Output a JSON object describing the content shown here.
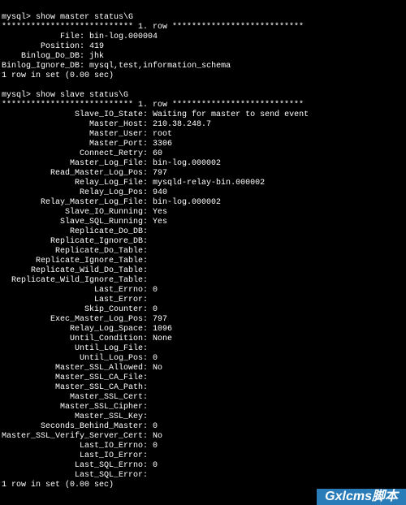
{
  "prompt_prefix": "mysql> ",
  "cmd_master": "show master status\\G",
  "row_header": "*************************** 1. row ***************************",
  "master_status": [
    {
      "key": "File",
      "val": "bin-log.000004"
    },
    {
      "key": "Position",
      "val": "419"
    },
    {
      "key": "Binlog_Do_DB",
      "val": "jhk"
    },
    {
      "key": "Binlog_Ignore_DB",
      "val": "mysql,test,information_schema"
    }
  ],
  "rows_in_set": "1 row in set (0.00 sec)",
  "cmd_slave": "show slave status\\G",
  "slave_status": [
    {
      "key": "Slave_IO_State",
      "val": "Waiting for master to send event"
    },
    {
      "key": "Master_Host",
      "val": "210.38.248.7"
    },
    {
      "key": "Master_User",
      "val": "root"
    },
    {
      "key": "Master_Port",
      "val": "3306"
    },
    {
      "key": "Connect_Retry",
      "val": "60"
    },
    {
      "key": "Master_Log_File",
      "val": "bin-log.000002"
    },
    {
      "key": "Read_Master_Log_Pos",
      "val": "797"
    },
    {
      "key": "Relay_Log_File",
      "val": "mysqld-relay-bin.000002"
    },
    {
      "key": "Relay_Log_Pos",
      "val": "940"
    },
    {
      "key": "Relay_Master_Log_File",
      "val": "bin-log.000002"
    },
    {
      "key": "Slave_IO_Running",
      "val": "Yes"
    },
    {
      "key": "Slave_SQL_Running",
      "val": "Yes"
    },
    {
      "key": "Replicate_Do_DB",
      "val": ""
    },
    {
      "key": "Replicate_Ignore_DB",
      "val": ""
    },
    {
      "key": "Replicate_Do_Table",
      "val": ""
    },
    {
      "key": "Replicate_Ignore_Table",
      "val": ""
    },
    {
      "key": "Replicate_Wild_Do_Table",
      "val": ""
    },
    {
      "key": "Replicate_Wild_Ignore_Table",
      "val": ""
    },
    {
      "key": "Last_Errno",
      "val": "0"
    },
    {
      "key": "Last_Error",
      "val": ""
    },
    {
      "key": "Skip_Counter",
      "val": "0"
    },
    {
      "key": "Exec_Master_Log_Pos",
      "val": "797"
    },
    {
      "key": "Relay_Log_Space",
      "val": "1096"
    },
    {
      "key": "Until_Condition",
      "val": "None"
    },
    {
      "key": "Until_Log_File",
      "val": ""
    },
    {
      "key": "Until_Log_Pos",
      "val": "0"
    },
    {
      "key": "Master_SSL_Allowed",
      "val": "No"
    },
    {
      "key": "Master_SSL_CA_File",
      "val": ""
    },
    {
      "key": "Master_SSL_CA_Path",
      "val": ""
    },
    {
      "key": "Master_SSL_Cert",
      "val": ""
    },
    {
      "key": "Master_SSL_Cipher",
      "val": ""
    },
    {
      "key": "Master_SSL_Key",
      "val": ""
    },
    {
      "key": "Seconds_Behind_Master",
      "val": "0"
    },
    {
      "key": "Master_SSL_Verify_Server_Cert",
      "val": "No"
    },
    {
      "key": "Last_IO_Errno",
      "val": "0"
    },
    {
      "key": "Last_IO_Error",
      "val": ""
    },
    {
      "key": "Last_SQL_Errno",
      "val": "0"
    },
    {
      "key": "Last_SQL_Error",
      "val": ""
    }
  ],
  "master_key_width": 16,
  "slave_key_width": 29,
  "watermark": "Gxlcms脚本"
}
